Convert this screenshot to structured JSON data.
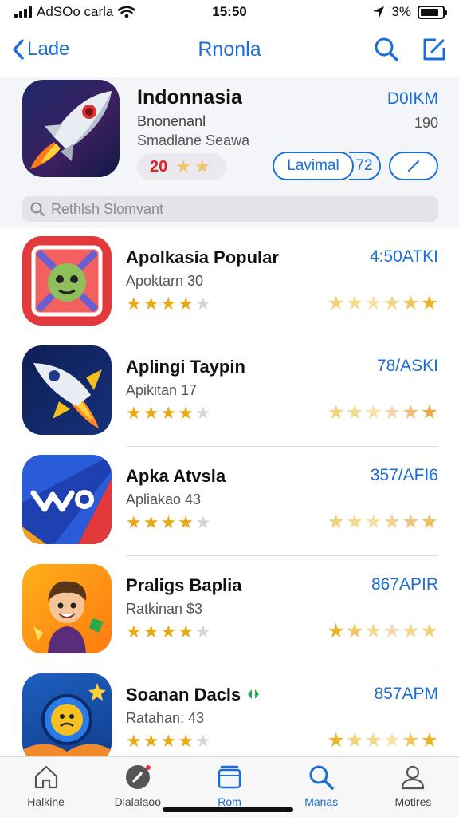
{
  "status_bar": {
    "carrier": "AdSOo carla",
    "time": "15:50",
    "battery": "3%"
  },
  "nav": {
    "back_label": "Lade",
    "title": "Rnonla",
    "accent_color": "#1a6fd6"
  },
  "featured": {
    "name": "Indonnasia",
    "subtitle1": "Bnonenanl",
    "subtitle2": "Smadlane Seawa",
    "price": "D0IKM",
    "count": "190",
    "rating": "20",
    "install_label": "Lavimal",
    "install_count": "72",
    "search_placeholder": "Rethlsh Slomvant"
  },
  "apps": [
    {
      "name": "Apolkasia Popular",
      "subtitle": "Apoktarn 30",
      "price": "4:50ATKI",
      "icon": "alien-face-icon"
    },
    {
      "name": "Aplingi Taypin",
      "subtitle": "Apikitan 17",
      "price": "78/ASKI",
      "icon": "rocket-icon"
    },
    {
      "name": "Apka Atvsla",
      "subtitle": "Apliakao 43",
      "price": "357/AFI6",
      "icon": "abstract-letter-icon"
    },
    {
      "name": "Praligs Baplia",
      "subtitle": "Ratkinan $3",
      "price": "867APIR",
      "icon": "cartoon-boy-icon"
    },
    {
      "name": "Soanan Dacls",
      "subtitle": "Ratahan: 43",
      "price": "857APM",
      "icon": "planet-face-icon"
    }
  ],
  "tabs": [
    {
      "label": "Halkine",
      "icon": "home-icon",
      "active": false
    },
    {
      "label": "Dlalalaoo",
      "icon": "compass-icon",
      "active": false
    },
    {
      "label": "Rom",
      "icon": "stack-icon",
      "active": true
    },
    {
      "label": "Manas",
      "icon": "search-icon",
      "active": true
    },
    {
      "label": "Motires",
      "icon": "person-icon",
      "active": false
    }
  ]
}
